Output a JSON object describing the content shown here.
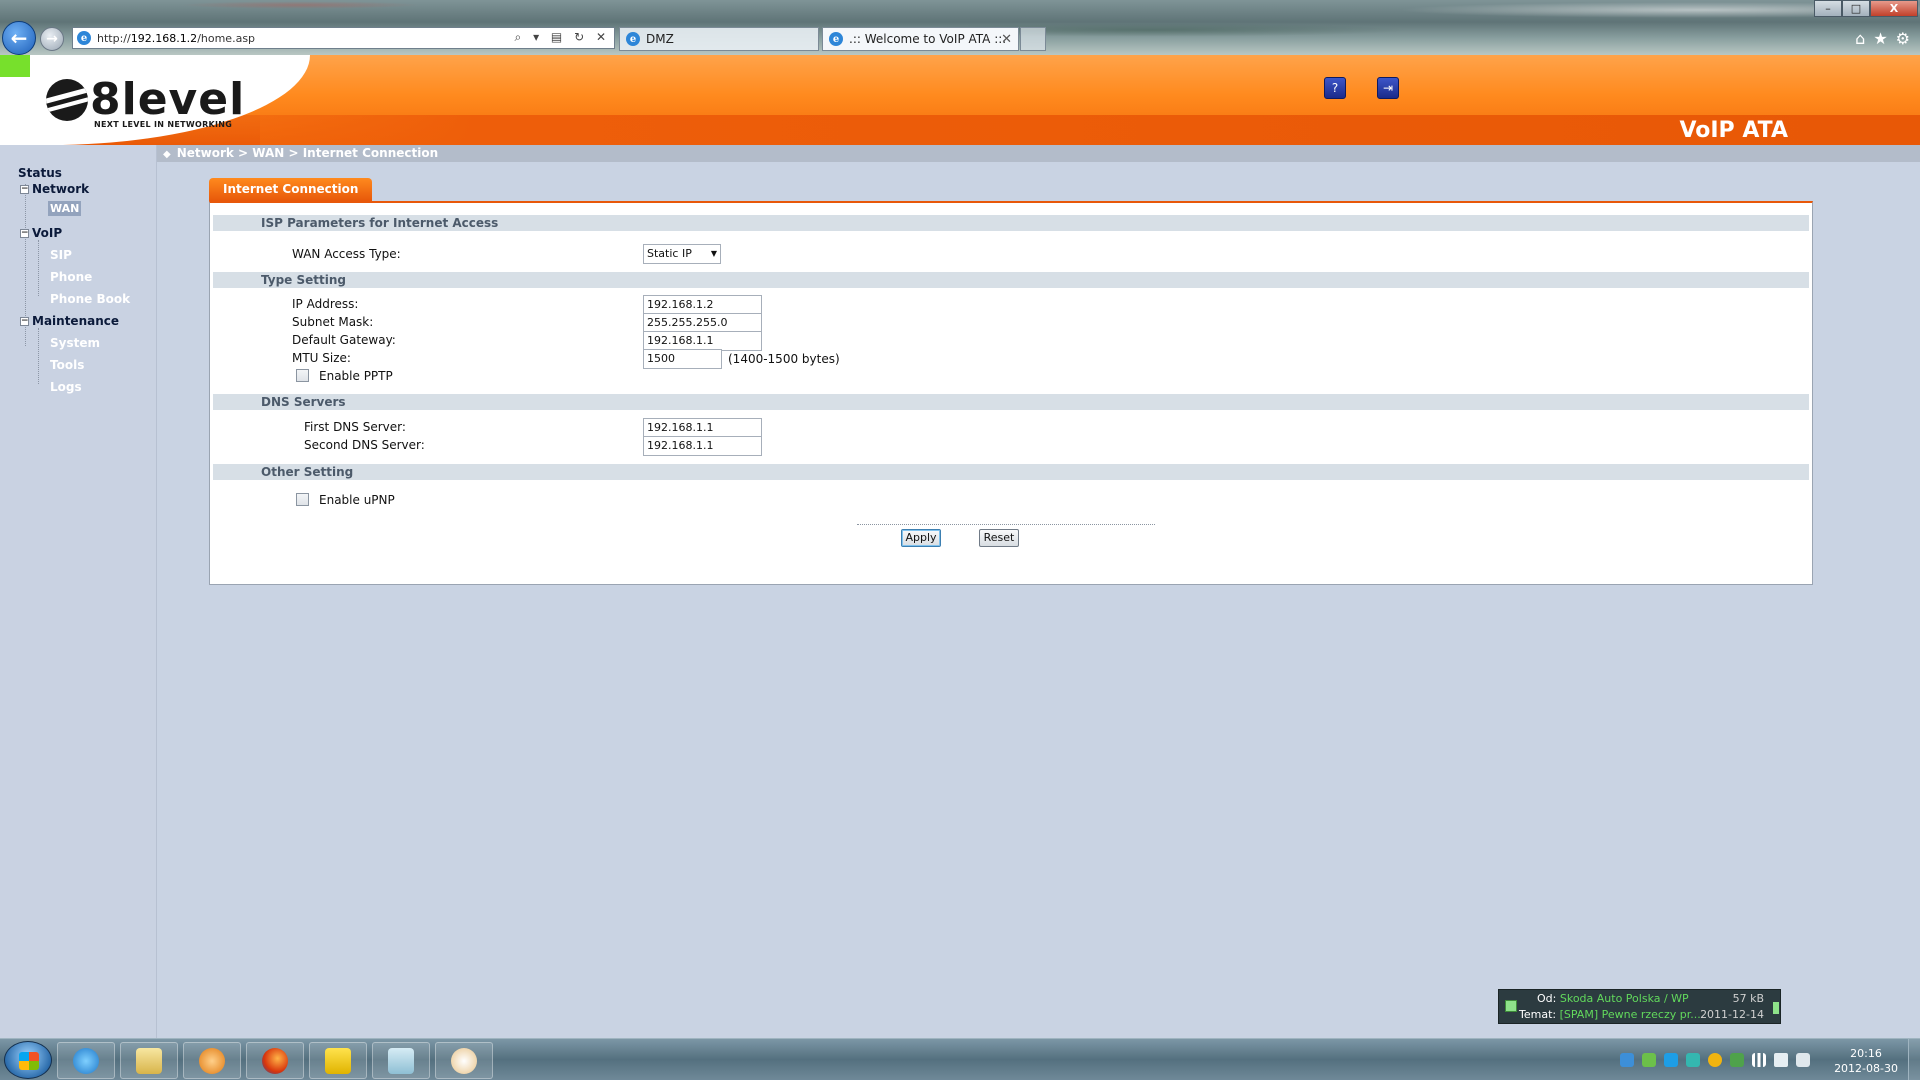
{
  "browser": {
    "url_prefix": "http://",
    "url_host": "192.168.1.2",
    "url_path": "/home.asp",
    "address_icons": "⌕ ▾ ▤ ↻ ✕",
    "tabs": [
      {
        "label": "DMZ"
      },
      {
        "label": ".:: Welcome to VoIP ATA ::.",
        "close": "✕"
      }
    ],
    "window_controls": {
      "minimize": "–",
      "maximize": "□",
      "close": "X"
    },
    "right_icons": {
      "home": "⌂",
      "favorites": "★",
      "tools": "⚙"
    }
  },
  "header": {
    "logo_text": "8level",
    "logo_tagline": "NEXT LEVEL IN NETWORKING",
    "product_name": "VoIP ATA",
    "help_icon_glyph": "?",
    "logout_icon_glyph": "⇥"
  },
  "sidebar": {
    "status": "Status",
    "groups": [
      {
        "label": "Network",
        "toggle": "−",
        "items": [
          {
            "label": "WAN",
            "active": true
          }
        ]
      },
      {
        "label": "VoIP",
        "toggle": "−",
        "items": [
          {
            "label": "SIP"
          },
          {
            "label": "Phone"
          },
          {
            "label": "Phone Book"
          }
        ]
      },
      {
        "label": "Maintenance",
        "toggle": "−",
        "items": [
          {
            "label": "System"
          },
          {
            "label": "Tools"
          },
          {
            "label": "Logs"
          }
        ]
      }
    ]
  },
  "breadcrumb": {
    "diamond": "◆",
    "path": "Network > WAN > Internet Connection"
  },
  "panel": {
    "tab_title": "Internet Connection",
    "sections": {
      "isp": "ISP Parameters for Internet Access",
      "type": "Type Setting",
      "dns": "DNS Servers",
      "other": "Other Setting"
    },
    "wan_access_type": {
      "label": "WAN Access Type:",
      "value": "Static IP",
      "caret": "▼"
    },
    "ip_address": {
      "label": "IP Address:",
      "value": "192.168.1.2"
    },
    "subnet_mask": {
      "label": "Subnet Mask:",
      "value": "255.255.255.0"
    },
    "default_gateway": {
      "label": "Default Gateway:",
      "value": "192.168.1.1"
    },
    "mtu_size": {
      "label": "MTU Size:",
      "value": "1500",
      "hint": "(1400-1500 bytes)"
    },
    "enable_pptp": {
      "label": "Enable PPTP",
      "checked": false
    },
    "first_dns": {
      "label": "First DNS Server:",
      "value": "192.168.1.1"
    },
    "second_dns": {
      "label": "Second DNS Server:",
      "value": "192.168.1.1"
    },
    "enable_upnp": {
      "label": "Enable uPNP",
      "checked": false
    },
    "apply_label": "Apply",
    "reset_label": "Reset"
  },
  "notification": {
    "from_label": "Od:",
    "from_value": "Skoda Auto Polska / WP",
    "size": "57 kB",
    "subject_label": "Temat:",
    "subject_value": "[SPAM] Pewne rzeczy pr...",
    "date": "2011-12-14"
  },
  "taskbar": {
    "time": "20:16",
    "date": "2012-08-30"
  },
  "colors": {
    "header_orange": "#ff8a1e",
    "accent_orange": "#e8580a",
    "sidebar_bg": "#c9d2e2",
    "section_bg": "#d7dfe6",
    "notify_green": "#62d95c"
  }
}
